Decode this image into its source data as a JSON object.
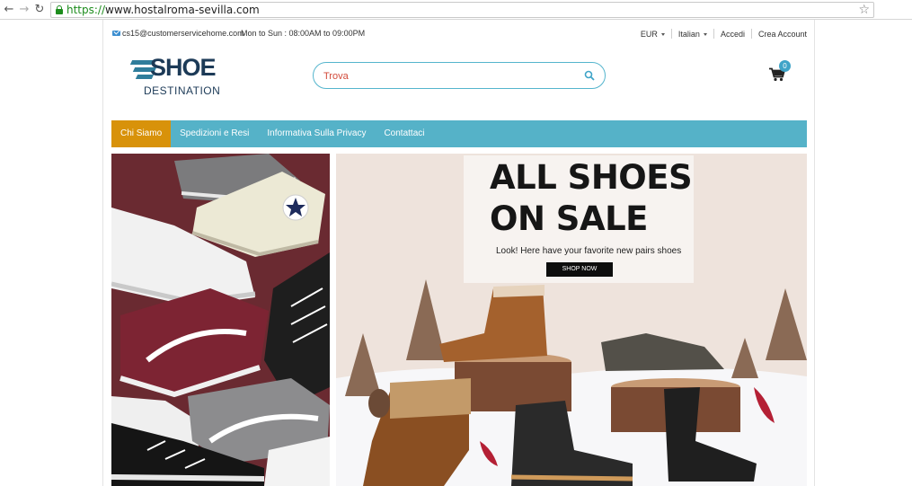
{
  "browser": {
    "url_scheme": "https://",
    "url_host": "www.hostalroma-sevilla.com"
  },
  "topbar": {
    "email": "cs15@customerservicehome.com",
    "hours": "Mon to Sun : 08:00AM to 09:00PM",
    "currency": "EUR",
    "language": "Italian",
    "login": "Accedi",
    "register": "Crea Account"
  },
  "logo": {
    "word": "SHOE",
    "sub": "DESTINATION"
  },
  "search": {
    "placeholder": "Trova"
  },
  "cart": {
    "count": "0"
  },
  "menu": {
    "items": [
      {
        "label": "Chi Siamo",
        "active": true
      },
      {
        "label": "Spedizioni e Resi",
        "active": false
      },
      {
        "label": "Informativa Sulla Privacy",
        "active": false
      },
      {
        "label": "Contattaci",
        "active": false
      }
    ]
  },
  "promo": {
    "title": "ALL SHOES\nON SALE",
    "subtitle": "Look! Here have your favorite new pairs shoes",
    "button": "SHOP NOW"
  },
  "colors": {
    "accent": "#55b2c8",
    "active_menu": "#d8920a",
    "logo": "#1c3a57"
  }
}
